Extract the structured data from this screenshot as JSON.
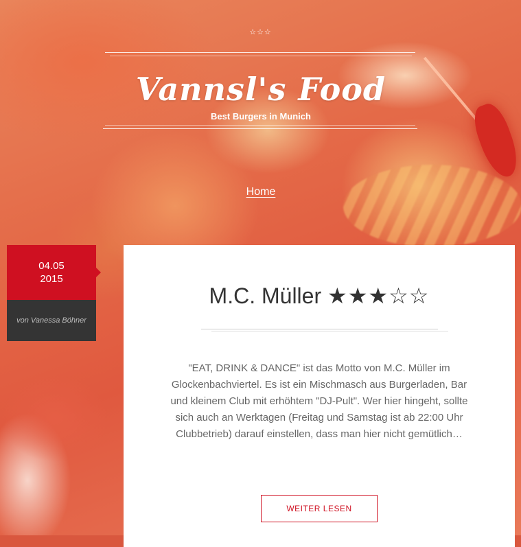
{
  "header": {
    "top_stars": "☆☆☆",
    "site_title": "Vannsl's Food",
    "tagline": "Best Burgers in Munich"
  },
  "nav": {
    "home_label": "Home"
  },
  "post": {
    "date_line1": "04.05",
    "date_line2": "2015",
    "author": "von Vanessa Böhner",
    "title": "M.C. Müller",
    "rating_stars": "★★★☆☆",
    "rating": {
      "value": 3,
      "max": 5
    },
    "excerpt": "\"EAT, DRINK & DANCE\" ist das Motto von M.C. Müller im Glockenbachviertel. Es ist ein Mischmasch aus Burgerladen, Bar und kleinem Club mit erhöhtem \"DJ-Pult\". Wer hier hingeht, sollte sich auch an Werktagen (Freitag und Samstag ist ab 22:00 Uhr Clubbetrieb) darauf einstellen, dass man hier nicht gemütlich…",
    "read_more_label": "WEITER LESEN"
  },
  "colors": {
    "accent": "#cf1021",
    "author_badge_bg": "#343434",
    "card_bg": "#ffffff"
  }
}
